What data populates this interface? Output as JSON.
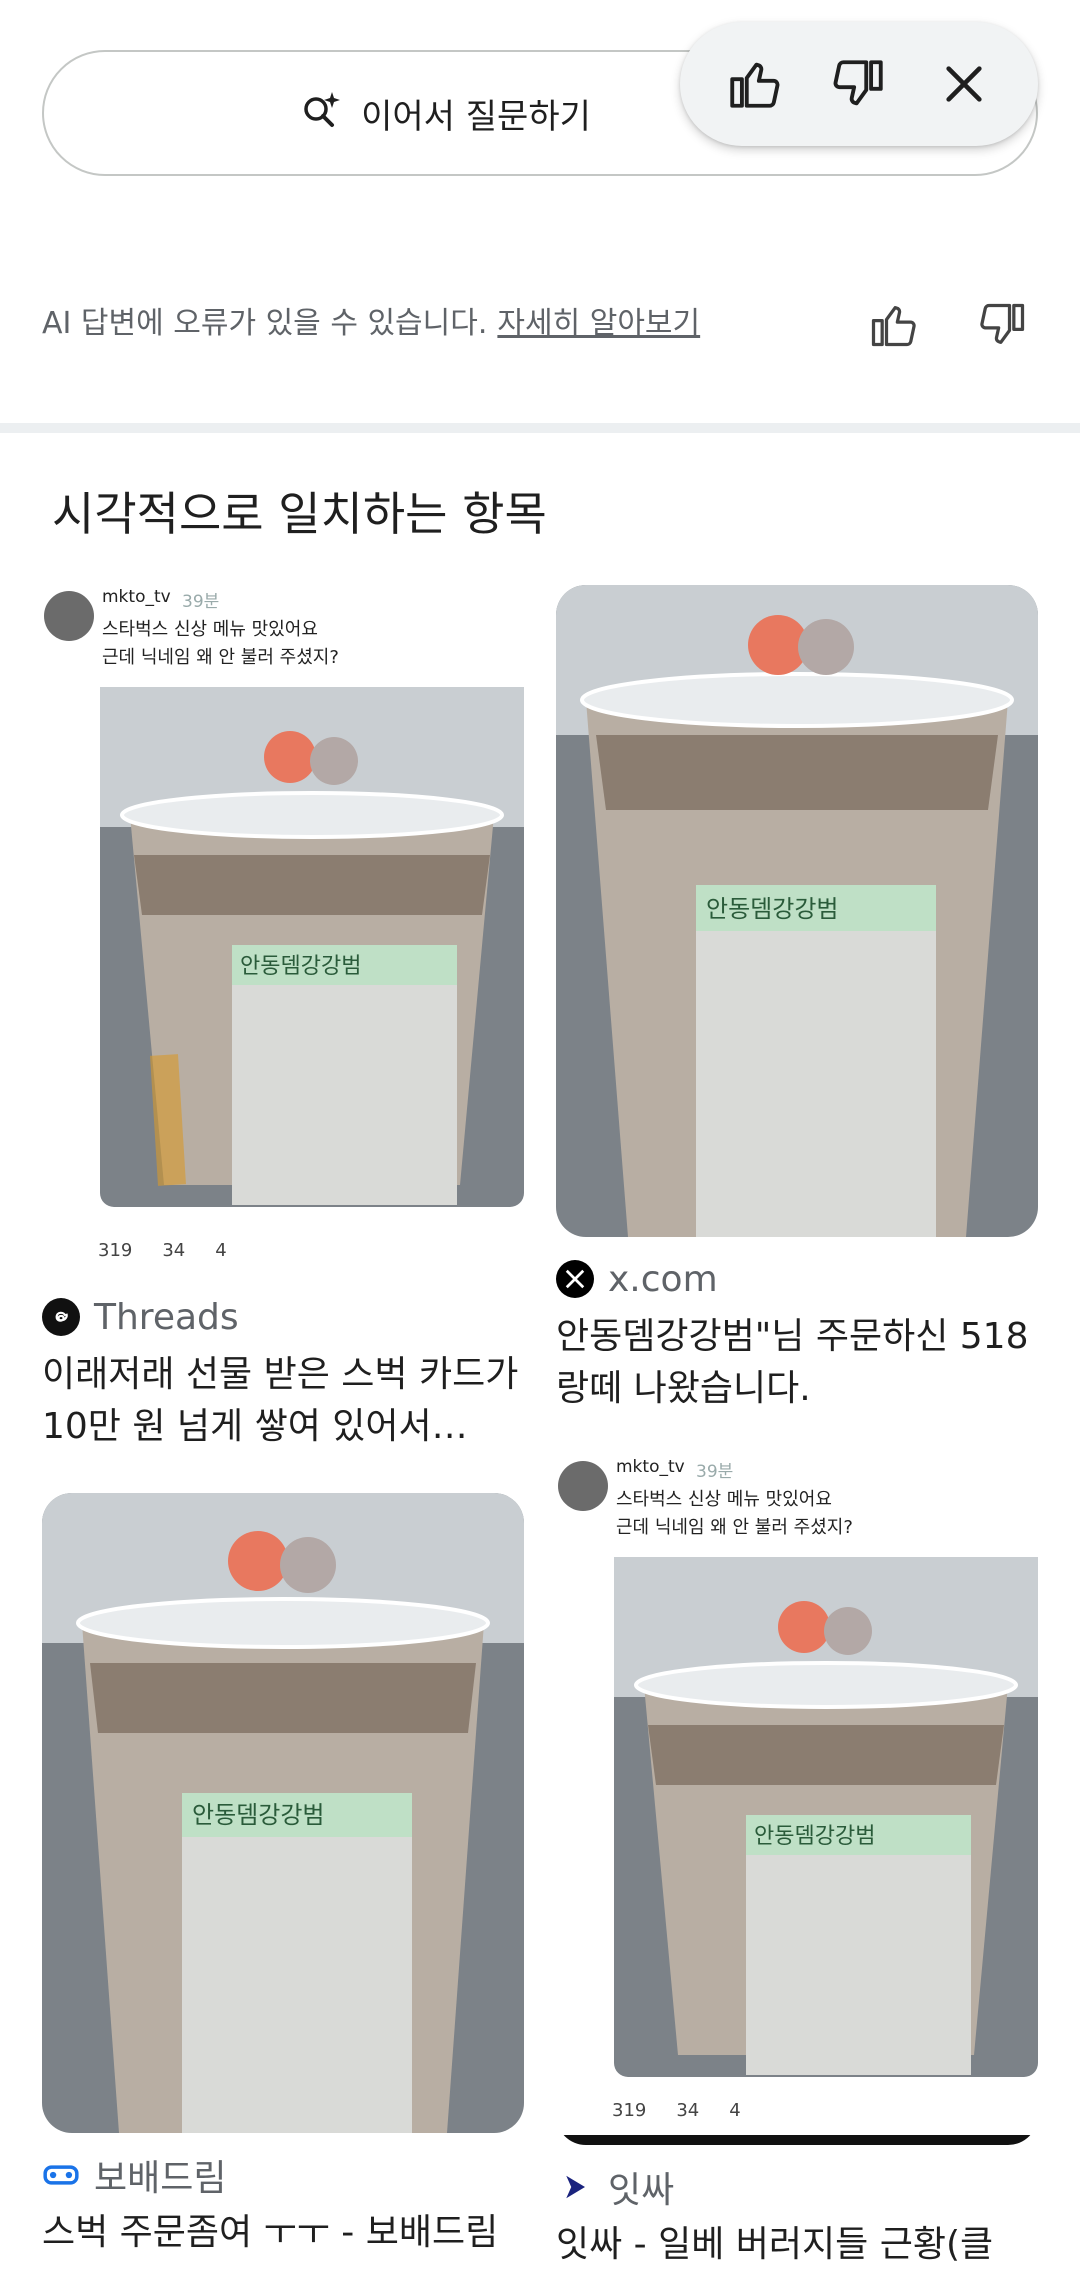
{
  "followup": {
    "label": "이어서 질문하기"
  },
  "disclaimer": {
    "text": "AI 답변에 오류가 있을 수 있습니다.",
    "link": "자세히 알아보기"
  },
  "section": {
    "title": "시각적으로 일치하는 항목"
  },
  "cards": [
    {
      "source": "Threads",
      "title": "이래저래 선물 받은 스벅 카드가 10만 원 넘게 쌓여 있어서…",
      "handle": "mkto_tv",
      "time": "39분",
      "line1": "스타벅스 신상 메뉴 맛있어요",
      "line2": "근데 닉네임 왜 안 불러 주셨지?",
      "stats": [
        "319",
        "34",
        "4"
      ]
    },
    {
      "source": "x.com",
      "title": "안동뎀강강범\"님 주문하신 518랑떼 나왔습니다."
    },
    {
      "source": "보배드림",
      "title": "스벅 주문좀여 ㅜㅜ - 보배드림"
    },
    {
      "source": "잇싸",
      "title": "잇싸 - 일베 버러지들 근황(클",
      "handle": "mkto_tv",
      "time": "39분",
      "line1": "스타벅스 신상 메뉴 맛있어요",
      "line2": "근데 닉네임 왜 안 불러 주셨지?",
      "stats": [
        "319",
        "34",
        "4"
      ]
    }
  ],
  "cup_label": "안동뎀강강범",
  "colors": {
    "divider": "#eceff1",
    "muted": "#5f6368",
    "x_brand": "#000000",
    "bobae": "#1a73e8",
    "itssa": "#1a237e"
  }
}
